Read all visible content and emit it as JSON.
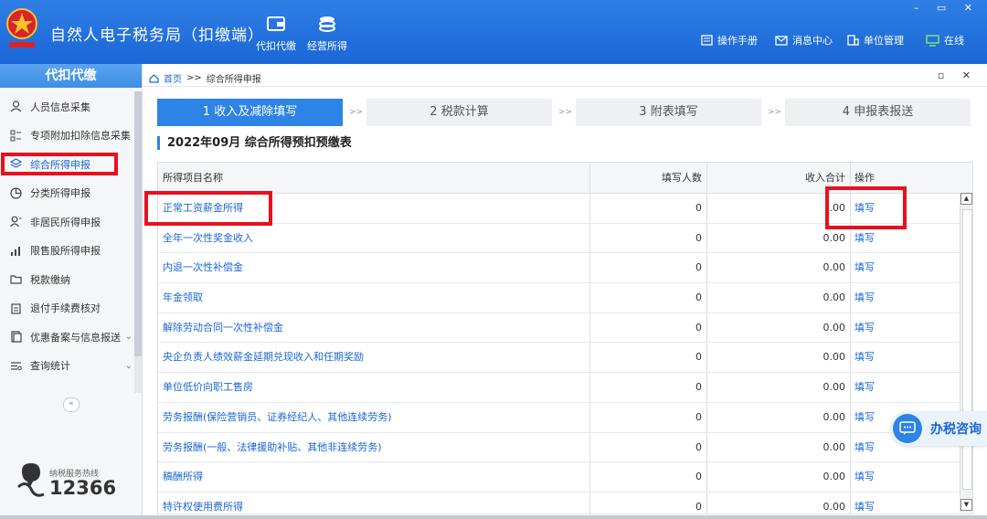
{
  "app": {
    "title": "自然人电子税务局（扣缴端）",
    "toolbar": [
      {
        "label": "代扣代缴",
        "icon": "wallet-icon"
      },
      {
        "label": "经营所得",
        "icon": "coins-icon"
      }
    ],
    "top_links": [
      {
        "label": "操作手册",
        "icon": "manual-icon"
      },
      {
        "label": "消息中心",
        "icon": "mail-icon"
      },
      {
        "label": "单位管理",
        "icon": "building-icon"
      },
      {
        "label": "在线",
        "icon": "monitor-icon"
      }
    ],
    "window_controls": "– ▭ ✕"
  },
  "sidebar": {
    "header": "代扣代缴",
    "items": [
      {
        "label": "人员信息采集",
        "icon": "person-icon"
      },
      {
        "label": "专项附加扣除信息采集",
        "icon": "grid-icon"
      },
      {
        "label": "综合所得申报",
        "icon": "layers-icon",
        "active": true
      },
      {
        "label": "分类所得申报",
        "icon": "pie-icon"
      },
      {
        "label": "非居民所得申报",
        "icon": "person-outline-icon"
      },
      {
        "label": "限售股所得申报",
        "icon": "signal-icon"
      },
      {
        "label": "税款缴纳",
        "icon": "folder-icon"
      },
      {
        "label": "退付手续费核对",
        "icon": "clipboard-icon"
      },
      {
        "label": "优惠备案与信息报送",
        "icon": "doc-icon",
        "has_arrow": true
      },
      {
        "label": "查询统计",
        "icon": "list-icon",
        "has_arrow": true
      }
    ],
    "collapse": "«",
    "hotline_label": "纳税服务热线",
    "hotline_number": "12366"
  },
  "breadcrumb": {
    "home": "首页",
    "sep": ">>",
    "current": "综合所得申报",
    "controls": "▫ ✕"
  },
  "steps": [
    {
      "label": "1 收入及减除填写",
      "active": true
    },
    {
      "label": "2 税款计算"
    },
    {
      "label": "3 附表填写"
    },
    {
      "label": "4 申报表报送"
    }
  ],
  "step_sep": ">>",
  "section_title": "2022年09月  综合所得预扣预缴表",
  "table": {
    "headers": [
      "所得项目名称",
      "填写人数",
      "收入合计",
      "操作"
    ],
    "rows": [
      {
        "name": "正常工资薪金所得",
        "count": "0",
        "income": ".00",
        "action": "填写"
      },
      {
        "name": "全年一次性奖金收入",
        "count": "0",
        "income": "0.00",
        "action": "填写"
      },
      {
        "name": "内退一次性补偿金",
        "count": "0",
        "income": "0.00",
        "action": "填写"
      },
      {
        "name": "年金领取",
        "count": "0",
        "income": "0.00",
        "action": "填写"
      },
      {
        "name": "解除劳动合同一次性补偿金",
        "count": "0",
        "income": "0.00",
        "action": "填写"
      },
      {
        "name": "央企负责人绩效薪金延期兑现收入和任期奖励",
        "count": "0",
        "income": "0.00",
        "action": "填写"
      },
      {
        "name": "单位低价向职工售房",
        "count": "0",
        "income": "0.00",
        "action": "填写"
      },
      {
        "name": "劳务报酬(保险营销员、证券经纪人、其他连续劳务)",
        "count": "0",
        "income": "0.00",
        "action": "填写"
      },
      {
        "name": "劳务报酬(一般、法律援助补贴、其他非连续劳务)",
        "count": "0",
        "income": "0.00",
        "action": "填写"
      },
      {
        "name": "稿酬所得",
        "count": "0",
        "income": "0.00",
        "action": "填写"
      },
      {
        "name": "特许权使用费所得",
        "count": "0",
        "income": "0.00",
        "action": "填写"
      }
    ]
  },
  "consult": "办税咨询",
  "colors": {
    "brand": "#1a66d6",
    "highlight": "#e8101e"
  }
}
